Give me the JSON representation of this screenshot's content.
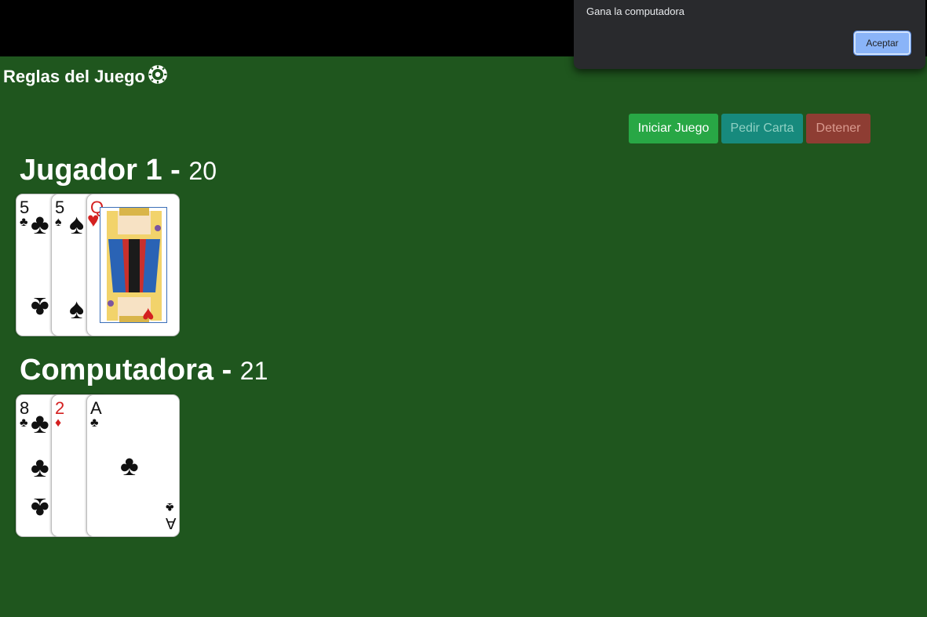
{
  "dialog": {
    "message": "Gana la computadora",
    "accept_label": "Aceptar"
  },
  "header": {
    "rules_label": "Reglas del Juego",
    "rules_icon": "gear-icon"
  },
  "controls": {
    "start_label": "Iniciar Juego",
    "ask_card_label": "Pedir Carta",
    "stop_label": "Detener"
  },
  "players": [
    {
      "name": "Jugador 1",
      "separator": "-",
      "score": "20",
      "cards": [
        {
          "rank": "5",
          "suit": "♣",
          "color": "black"
        },
        {
          "rank": "5",
          "suit": "♠",
          "color": "black"
        },
        {
          "rank": "Q",
          "suit": "♥",
          "color": "red"
        }
      ]
    },
    {
      "name": "Computadora",
      "separator": "-",
      "score": "21",
      "cards": [
        {
          "rank": "8",
          "suit": "♣",
          "color": "black"
        },
        {
          "rank": "2",
          "suit": "♦",
          "color": "red"
        },
        {
          "rank": "A",
          "suit": "♣",
          "color": "black"
        }
      ]
    }
  ],
  "colors": {
    "table_green": "#1f561e",
    "start_button": "#28a745",
    "ask_button": "#178a7d",
    "stop_button": "#8e3d33",
    "dialog_bg": "#292a2d",
    "dialog_button": "#8ab4f8"
  }
}
